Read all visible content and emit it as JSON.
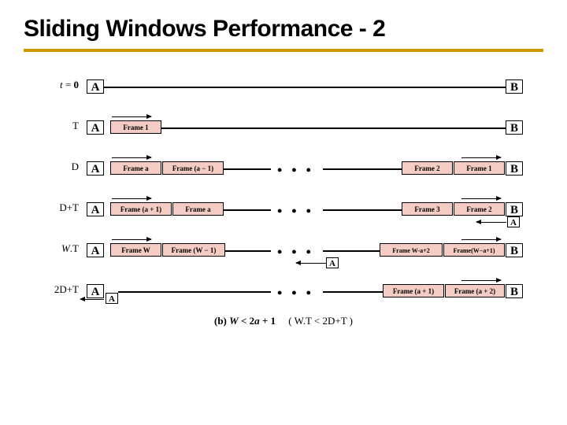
{
  "title": "Sliding Windows Performance - 2",
  "rows": {
    "r0": {
      "t_html": "<span class='it'>t</span> = <b>0</b>",
      "A": "A",
      "B": "B"
    },
    "r1": {
      "t": "T",
      "A": "A",
      "B": "B",
      "f1": "Frame 1"
    },
    "r2": {
      "t": "D",
      "A": "A",
      "B": "B",
      "fa": "Frame a",
      "fam1": "Frame (a − 1)",
      "f2": "Frame 2",
      "f1": "Frame 1"
    },
    "r3": {
      "t": "D+T",
      "A": "A",
      "B": "B",
      "fap1": "Frame (a + 1)",
      "fa": "Frame a",
      "f3": "Frame 3",
      "f2": "Frame 2",
      "ack": "A"
    },
    "r4": {
      "t_html": "<span class='it'>W</span>.T",
      "A": "A",
      "B": "B",
      "fW": "Frame W",
      "fWm1": "Frame (W − 1)",
      "fWap2": "Frame W-a+2",
      "fWap1": "Frame(W−a+1)",
      "ack": "A"
    },
    "r5": {
      "t": "2D+T",
      "A": "A",
      "B": "B",
      "ack": "A",
      "fap1": "Frame (a + 1)",
      "fap2": "Frame (a + 2)"
    }
  },
  "caption": {
    "label": "(b)",
    "ineq_html": "<span class='it'>W</span> &lt; 2<span class='it'>a</span> + 1",
    "paren": "( W.T < 2D+T )"
  }
}
